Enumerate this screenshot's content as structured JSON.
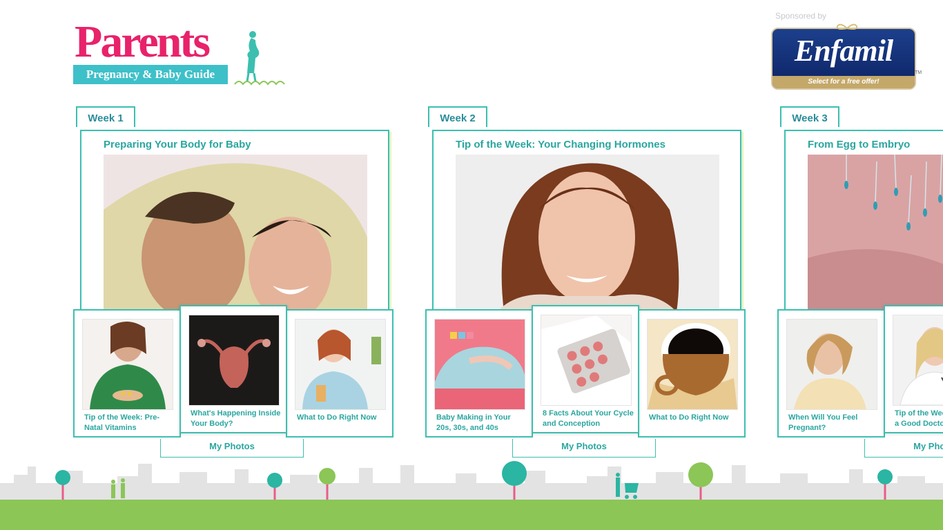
{
  "app": {
    "logo_word": "Parents",
    "logo_tagline": "Pregnancy & Baby Guide"
  },
  "sponsor": {
    "label": "Sponsored by",
    "brand": "Enfamil",
    "cta": "Select for a free offer!",
    "tm": "TM"
  },
  "colors": {
    "pink": "#e8226b",
    "teal": "#3cbfb0",
    "teal_text": "#2aa6a0",
    "ground": "#8bc657",
    "skyline": "#e3e3e3"
  },
  "weeks": [
    {
      "tab": "Week 1",
      "feature": {
        "title": "Preparing Your Body for Baby",
        "image": "couple-under-blanket"
      },
      "articles": [
        {
          "label": "Tip of the Week: Pre-Natal Vitamins",
          "image": "woman-holding-vitamins"
        },
        {
          "label": "What's Happening Inside Your Body?",
          "image": "uterus-illustration"
        },
        {
          "label": "What to Do Right Now",
          "image": "woman-with-juice"
        }
      ],
      "photos_label": "My Photos"
    },
    {
      "tab": "Week 2",
      "feature": {
        "title": "Tip of the Week: Your Changing Hormones",
        "image": "smiling-woman"
      },
      "articles": [
        {
          "label": "Baby Making in Your 20s, 30s, and 40s",
          "image": "pregnant-belly-blocks"
        },
        {
          "label": "8 Facts About Your Cycle and Conception",
          "image": "birth-control-pills"
        },
        {
          "label": "What to Do Right Now",
          "image": "coffee-cup"
        }
      ],
      "photos_label": "My Photos"
    },
    {
      "tab": "Week 3",
      "feature": {
        "title": "From Egg to Embryo",
        "image": "sperm-and-egg"
      },
      "articles": [
        {
          "label": "When Will You Feel Pregnant?",
          "image": "thoughtful-woman"
        },
        {
          "label": "Tip of the Week: Choose a Good Doctor",
          "image": "female-doctor"
        },
        {
          "label": "",
          "image": ""
        }
      ],
      "photos_label": "My Photos"
    }
  ]
}
